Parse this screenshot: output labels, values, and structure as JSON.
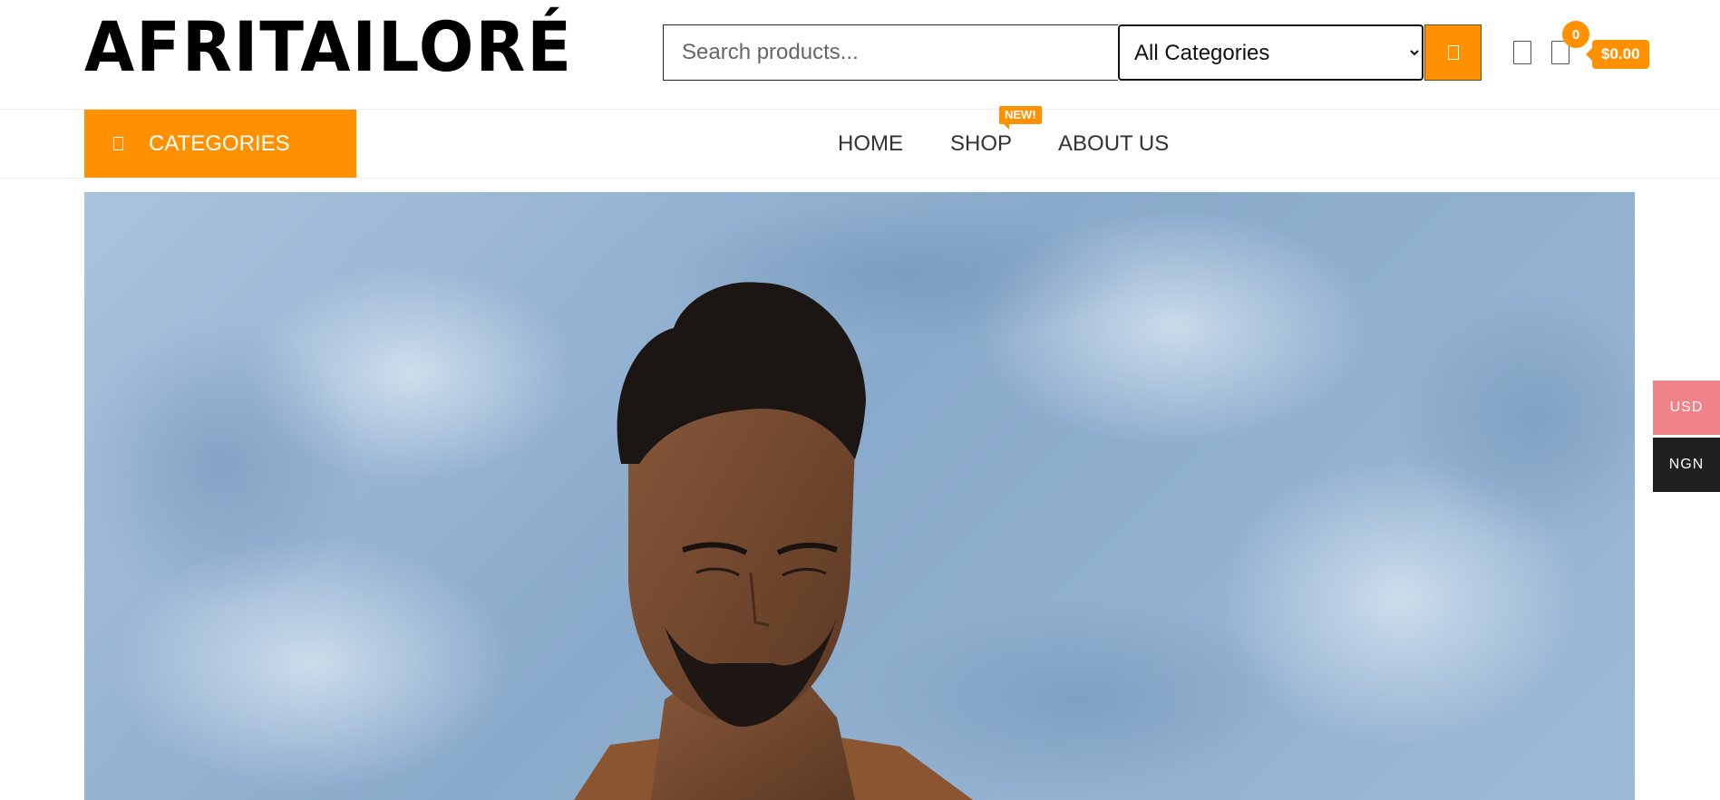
{
  "header": {
    "logo": "AFRITAILORÉ",
    "search_placeholder": "Search products...",
    "category_selected": "All Categories",
    "cart_count": "0",
    "cart_total": "$0.00"
  },
  "nav": {
    "categories_label": "CATEGORIES",
    "links": [
      "HOME",
      "SHOP",
      "ABOUT US"
    ],
    "shop_badge": "NEW!"
  },
  "currency": {
    "options": [
      "USD",
      "NGN"
    ]
  },
  "colors": {
    "accent": "#ff9100",
    "usd_bg": "#f0828a",
    "ngn_bg": "#202020",
    "hero_bg": "#9bb7d4"
  },
  "icons": {
    "search_button": "search-icon",
    "wishlist": "heart-icon",
    "cart": "cart-icon",
    "categories": "menu-icon"
  }
}
